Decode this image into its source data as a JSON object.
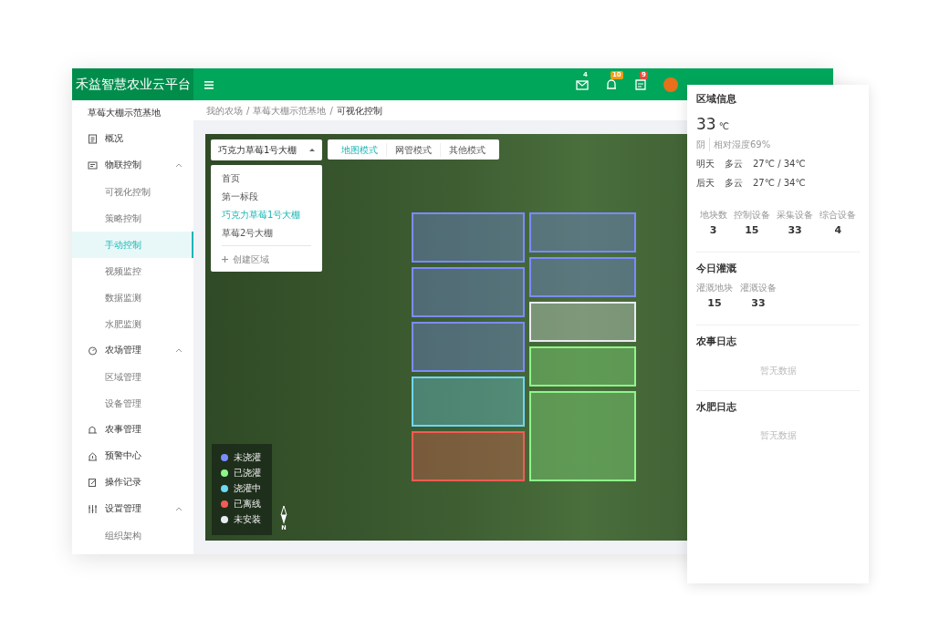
{
  "header": {
    "title": "禾益智慧农业云平台",
    "notifications": [
      {
        "count": "4",
        "kind": "text",
        "color": "#ffffff"
      },
      {
        "count": "10",
        "kind": "badge",
        "color": "#f39c12"
      },
      {
        "count": "9",
        "kind": "badge",
        "color": "#e74c3c"
      }
    ]
  },
  "sidebar": {
    "farm": "草莓大棚示范基地",
    "items": [
      {
        "label": "概况"
      },
      {
        "label": "物联控制",
        "expanded": true,
        "children": [
          {
            "label": "可视化控制",
            "selected": false
          },
          {
            "label": "策略控制",
            "selected": false
          },
          {
            "label": "手动控制",
            "selected": true
          },
          {
            "label": "视频监控",
            "selected": false
          },
          {
            "label": "数据监测",
            "selected": false
          },
          {
            "label": "水肥监测",
            "selected": false
          }
        ]
      },
      {
        "label": "农场管理",
        "expanded": true,
        "children": [
          {
            "label": "区域管理",
            "selected": false
          },
          {
            "label": "设备管理",
            "selected": false
          }
        ]
      },
      {
        "label": "农事管理"
      },
      {
        "label": "预警中心"
      },
      {
        "label": "操作记录"
      },
      {
        "label": "设置管理",
        "expanded": true,
        "children": [
          {
            "label": "组织架构",
            "selected": false
          }
        ]
      }
    ]
  },
  "breadcrumb": {
    "separator": "/",
    "items": [
      "我的农场",
      "草莓大棚示范基地",
      "可视化控制"
    ]
  },
  "map": {
    "area_select": {
      "value": "巧克力草莓1号大棚",
      "expanded": true,
      "options": [
        {
          "label": "首页",
          "selected": false
        },
        {
          "label": "第一标段",
          "selected": false
        },
        {
          "label": "巧克力草莓1号大棚",
          "selected": true
        },
        {
          "label": "草莓2号大棚",
          "selected": false
        }
      ],
      "create_label": "创建区域"
    },
    "modes": [
      {
        "label": "地图模式",
        "selected": true
      },
      {
        "label": "网管模式",
        "selected": false
      },
      {
        "label": "其他模式",
        "selected": false
      }
    ],
    "plot_columns": [
      [
        {
          "color": "#7b8cff",
          "kind": "normal"
        },
        {
          "color": "#7b8cff",
          "kind": "normal"
        },
        {
          "color": "#7b8cff",
          "kind": "normal"
        },
        {
          "color": "#6fd6f5",
          "kind": "normal"
        },
        {
          "color": "#f25c54",
          "kind": "normal"
        }
      ],
      [
        {
          "color": "#7b8cff",
          "kind": "normal"
        },
        {
          "color": "#7b8cff",
          "kind": "normal"
        },
        {
          "color": "#e8ecf2",
          "kind": "normal"
        },
        {
          "color": "#8ef58a",
          "kind": "normal"
        },
        {
          "color": "#8ef58a",
          "kind": "large"
        }
      ]
    ],
    "legend": [
      {
        "label": "未浇灌",
        "color": "#7b8cff"
      },
      {
        "label": "已浇灌",
        "color": "#8ef58a"
      },
      {
        "label": "浇灌中",
        "color": "#6fd6f5"
      },
      {
        "label": "已离线",
        "color": "#f25c54"
      },
      {
        "label": "未安装",
        "color": "#e8ecf2"
      }
    ],
    "compass": "N"
  },
  "panel": {
    "title": "区域信息",
    "temperature": "33",
    "unit": "℃",
    "weather": "阴",
    "humidity": "相对湿度69%",
    "forecast": [
      {
        "day": "明天",
        "weather": "多云",
        "temp": "27℃ / 34℃"
      },
      {
        "day": "后天",
        "weather": "多云",
        "temp": "27℃ / 34℃"
      }
    ],
    "stats": [
      {
        "label": "地块数",
        "value": "3"
      },
      {
        "label": "控制设备",
        "value": "15"
      },
      {
        "label": "采集设备",
        "value": "33"
      },
      {
        "label": "综合设备",
        "value": "4"
      }
    ],
    "irrigation": {
      "title": "今日灌溉",
      "stats": [
        {
          "label": "灌溉地块",
          "value": "15"
        },
        {
          "label": "灌溉设备",
          "value": "33"
        }
      ]
    },
    "logs": [
      {
        "title": "农事日志",
        "empty": "暂无数据"
      },
      {
        "title": "水肥日志",
        "empty": "暂无数据"
      }
    ]
  }
}
